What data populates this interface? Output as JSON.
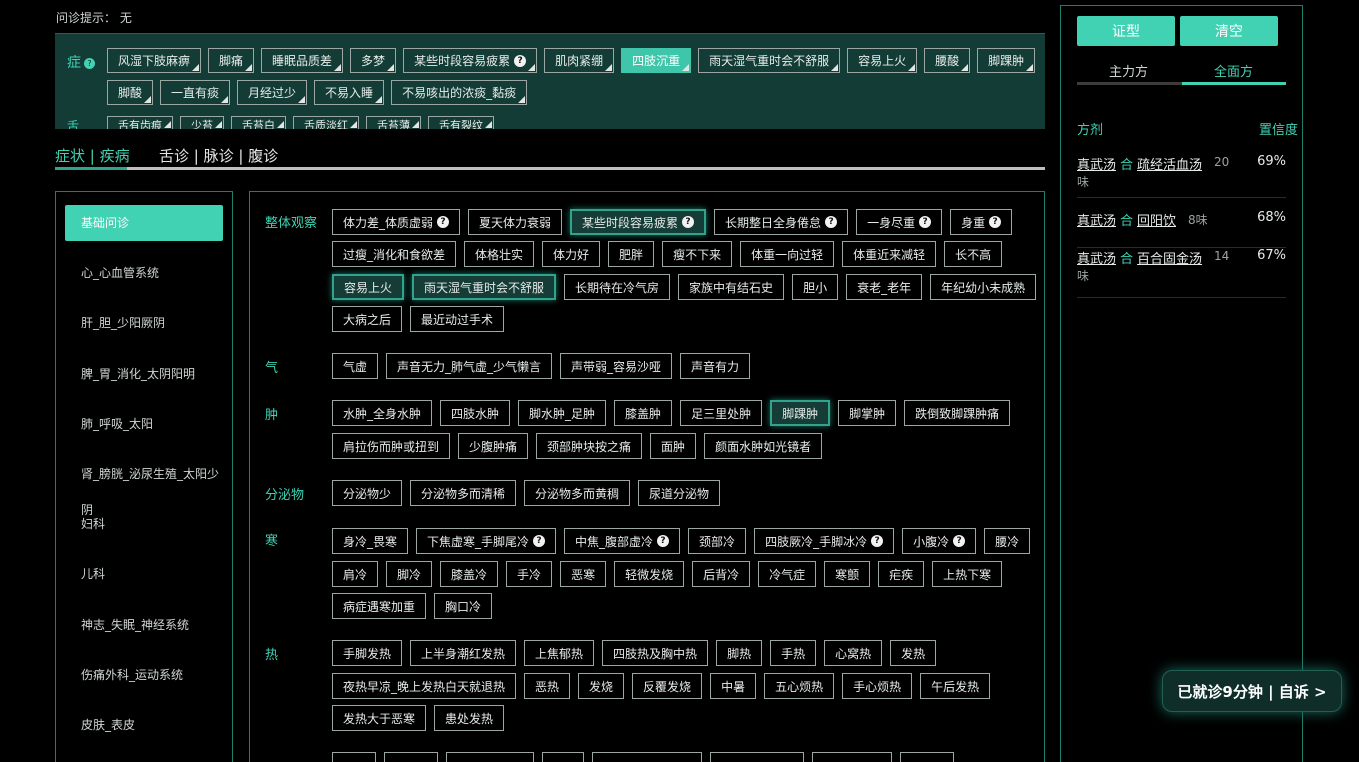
{
  "hint": {
    "label": "问诊提示：",
    "value": "无"
  },
  "selected": {
    "zheng_label": "症",
    "she_label": "舌",
    "row1": [
      {
        "t": "风湿下肢麻痹"
      },
      {
        "t": "脚痛"
      },
      {
        "t": "睡眠品质差"
      },
      {
        "t": "多梦"
      },
      {
        "t": "某些时段容易疲累",
        "q": true
      },
      {
        "t": "肌肉紧绷"
      },
      {
        "t": "四肢沉重",
        "hl": true
      },
      {
        "t": "雨天湿气重时会不舒服"
      },
      {
        "t": "容易上火"
      },
      {
        "t": "腰酸"
      },
      {
        "t": "脚踝肿"
      }
    ],
    "row2": [
      {
        "t": "脚酸"
      },
      {
        "t": "一直有痰"
      },
      {
        "t": "月经过少"
      },
      {
        "t": "不易入睡"
      },
      {
        "t": "不易咳出的浓痰_黏痰"
      }
    ],
    "row3": [
      {
        "t": "舌有齿痕"
      },
      {
        "t": "少苔"
      },
      {
        "t": "舌苔白"
      },
      {
        "t": "舌质淡红"
      },
      {
        "t": "舌苔薄"
      },
      {
        "t": "舌有裂纹"
      }
    ]
  },
  "tabs": {
    "t1": "症状 | 疾病",
    "t2": "舌诊 | 脉诊 | 腹诊"
  },
  "categories": [
    "基础问诊",
    "心_心血管系统",
    "肝_胆_少阳厥阴",
    "脾_胃_消化_太阴阳明",
    "肺_呼吸_太阳",
    "肾_膀胱_泌尿生殖_太阳少阴",
    "妇科",
    "儿科",
    "神志_失眠_神经系统",
    "伤痛外科_运动系统",
    "皮肤_表皮"
  ],
  "groups": {
    "overall": {
      "label": "整体观察",
      "rows": [
        [
          {
            "t": "体力差_体质虚弱",
            "q": true
          },
          {
            "t": "夏天体力衰弱"
          },
          {
            "t": "某些时段容易疲累",
            "q": true,
            "on": true
          },
          {
            "t": "长期整日全身倦怠",
            "q": true
          },
          {
            "t": "一身尽重",
            "q": true
          },
          {
            "t": "身重",
            "q": true
          }
        ],
        [
          {
            "t": "过瘦_消化和食欲差"
          },
          {
            "t": "体格壮实"
          },
          {
            "t": "体力好"
          },
          {
            "t": "肥胖"
          },
          {
            "t": "瘦不下来"
          },
          {
            "t": "体重一向过轻"
          },
          {
            "t": "体重近来减轻"
          },
          {
            "t": "长不高"
          }
        ],
        [
          {
            "t": "容易上火",
            "on": true
          },
          {
            "t": "雨天湿气重时会不舒服",
            "on": true
          },
          {
            "t": "长期待在冷气房"
          },
          {
            "t": "家族中有结石史"
          },
          {
            "t": "胆小"
          },
          {
            "t": "衰老_老年"
          },
          {
            "t": "年纪幼小未成熟"
          }
        ],
        [
          {
            "t": "大病之后"
          },
          {
            "t": "最近动过手术"
          }
        ]
      ]
    },
    "qi": {
      "label": "气",
      "rows": [
        [
          {
            "t": "气虚"
          },
          {
            "t": "声音无力_肺气虚_少气懒言"
          },
          {
            "t": "声带弱_容易沙哑"
          },
          {
            "t": "声音有力"
          }
        ]
      ]
    },
    "zhong": {
      "label": "肿",
      "rows": [
        [
          {
            "t": "水肿_全身水肿"
          },
          {
            "t": "四肢水肿"
          },
          {
            "t": "脚水肿_足肿"
          },
          {
            "t": "膝盖肿"
          },
          {
            "t": "足三里处肿"
          },
          {
            "t": "脚踝肿",
            "on": true
          },
          {
            "t": "脚掌肿"
          },
          {
            "t": "跌倒致脚踝肿痛"
          }
        ],
        [
          {
            "t": "肩拉伤而肿或扭到"
          },
          {
            "t": "少腹肿痛"
          },
          {
            "t": "颈部肿块按之痛"
          },
          {
            "t": "面肿"
          },
          {
            "t": "颜面水肿如光镜者"
          }
        ]
      ]
    },
    "fenmi": {
      "label": "分泌物",
      "rows": [
        [
          {
            "t": "分泌物少"
          },
          {
            "t": "分泌物多而清稀"
          },
          {
            "t": "分泌物多而黄稠"
          },
          {
            "t": "尿道分泌物"
          }
        ]
      ]
    },
    "han": {
      "label": "寒",
      "rows": [
        [
          {
            "t": "身冷_畏寒"
          },
          {
            "t": "下焦虚寒_手脚尾冷",
            "q": true
          },
          {
            "t": "中焦_腹部虚冷",
            "q": true
          },
          {
            "t": "颈部冷"
          },
          {
            "t": "四肢厥冷_手脚冰冷",
            "q": true
          },
          {
            "t": "小腹冷",
            "q": true
          },
          {
            "t": "腰冷"
          }
        ],
        [
          {
            "t": "肩冷"
          },
          {
            "t": "脚冷"
          },
          {
            "t": "膝盖冷"
          },
          {
            "t": "手冷"
          },
          {
            "t": "恶寒"
          },
          {
            "t": "轻微发烧"
          },
          {
            "t": "后背冷"
          },
          {
            "t": "冷气症"
          },
          {
            "t": "寒颤"
          },
          {
            "t": "疟疾"
          },
          {
            "t": "上热下寒"
          }
        ],
        [
          {
            "t": "病症遇寒加重"
          },
          {
            "t": "胸口冷"
          }
        ]
      ]
    },
    "re": {
      "label": "热",
      "rows": [
        [
          {
            "t": "手脚发热"
          },
          {
            "t": "上半身潮红发热"
          },
          {
            "t": "上焦郁热"
          },
          {
            "t": "四肢热及胸中热"
          },
          {
            "t": "脚热"
          },
          {
            "t": "手热"
          },
          {
            "t": "心窝热"
          },
          {
            "t": "发热"
          }
        ],
        [
          {
            "t": "夜热早凉_晚上发热白天就退热"
          },
          {
            "t": "恶热"
          },
          {
            "t": "发烧"
          },
          {
            "t": "反覆发烧"
          },
          {
            "t": "中暑"
          },
          {
            "t": "五心烦热"
          },
          {
            "t": "手心烦热"
          },
          {
            "t": "午后发热"
          }
        ],
        [
          {
            "t": "发热大于恶寒"
          },
          {
            "t": "患处发热"
          }
        ]
      ]
    }
  },
  "right": {
    "btn_zheng": "证型",
    "btn_clear": "清空",
    "tab_main": "主力方",
    "tab_full": "全面方",
    "head_formula": "方剂",
    "head_conf": "置信度",
    "formulas": [
      {
        "a": "真武汤",
        "he": "合",
        "b": "疏经活血汤",
        "count": "20",
        "wei": "味",
        "pct": "69%"
      },
      {
        "a": "真武汤",
        "he": "合",
        "b": "回阳饮",
        "count": "8味",
        "wei": "",
        "pct": "68%"
      },
      {
        "a": "真武汤",
        "he": "合",
        "b": "百合固金汤",
        "count": "14",
        "wei": "味",
        "pct": "67%"
      }
    ]
  },
  "banner": "已就诊9分钟 | 自诉 >"
}
